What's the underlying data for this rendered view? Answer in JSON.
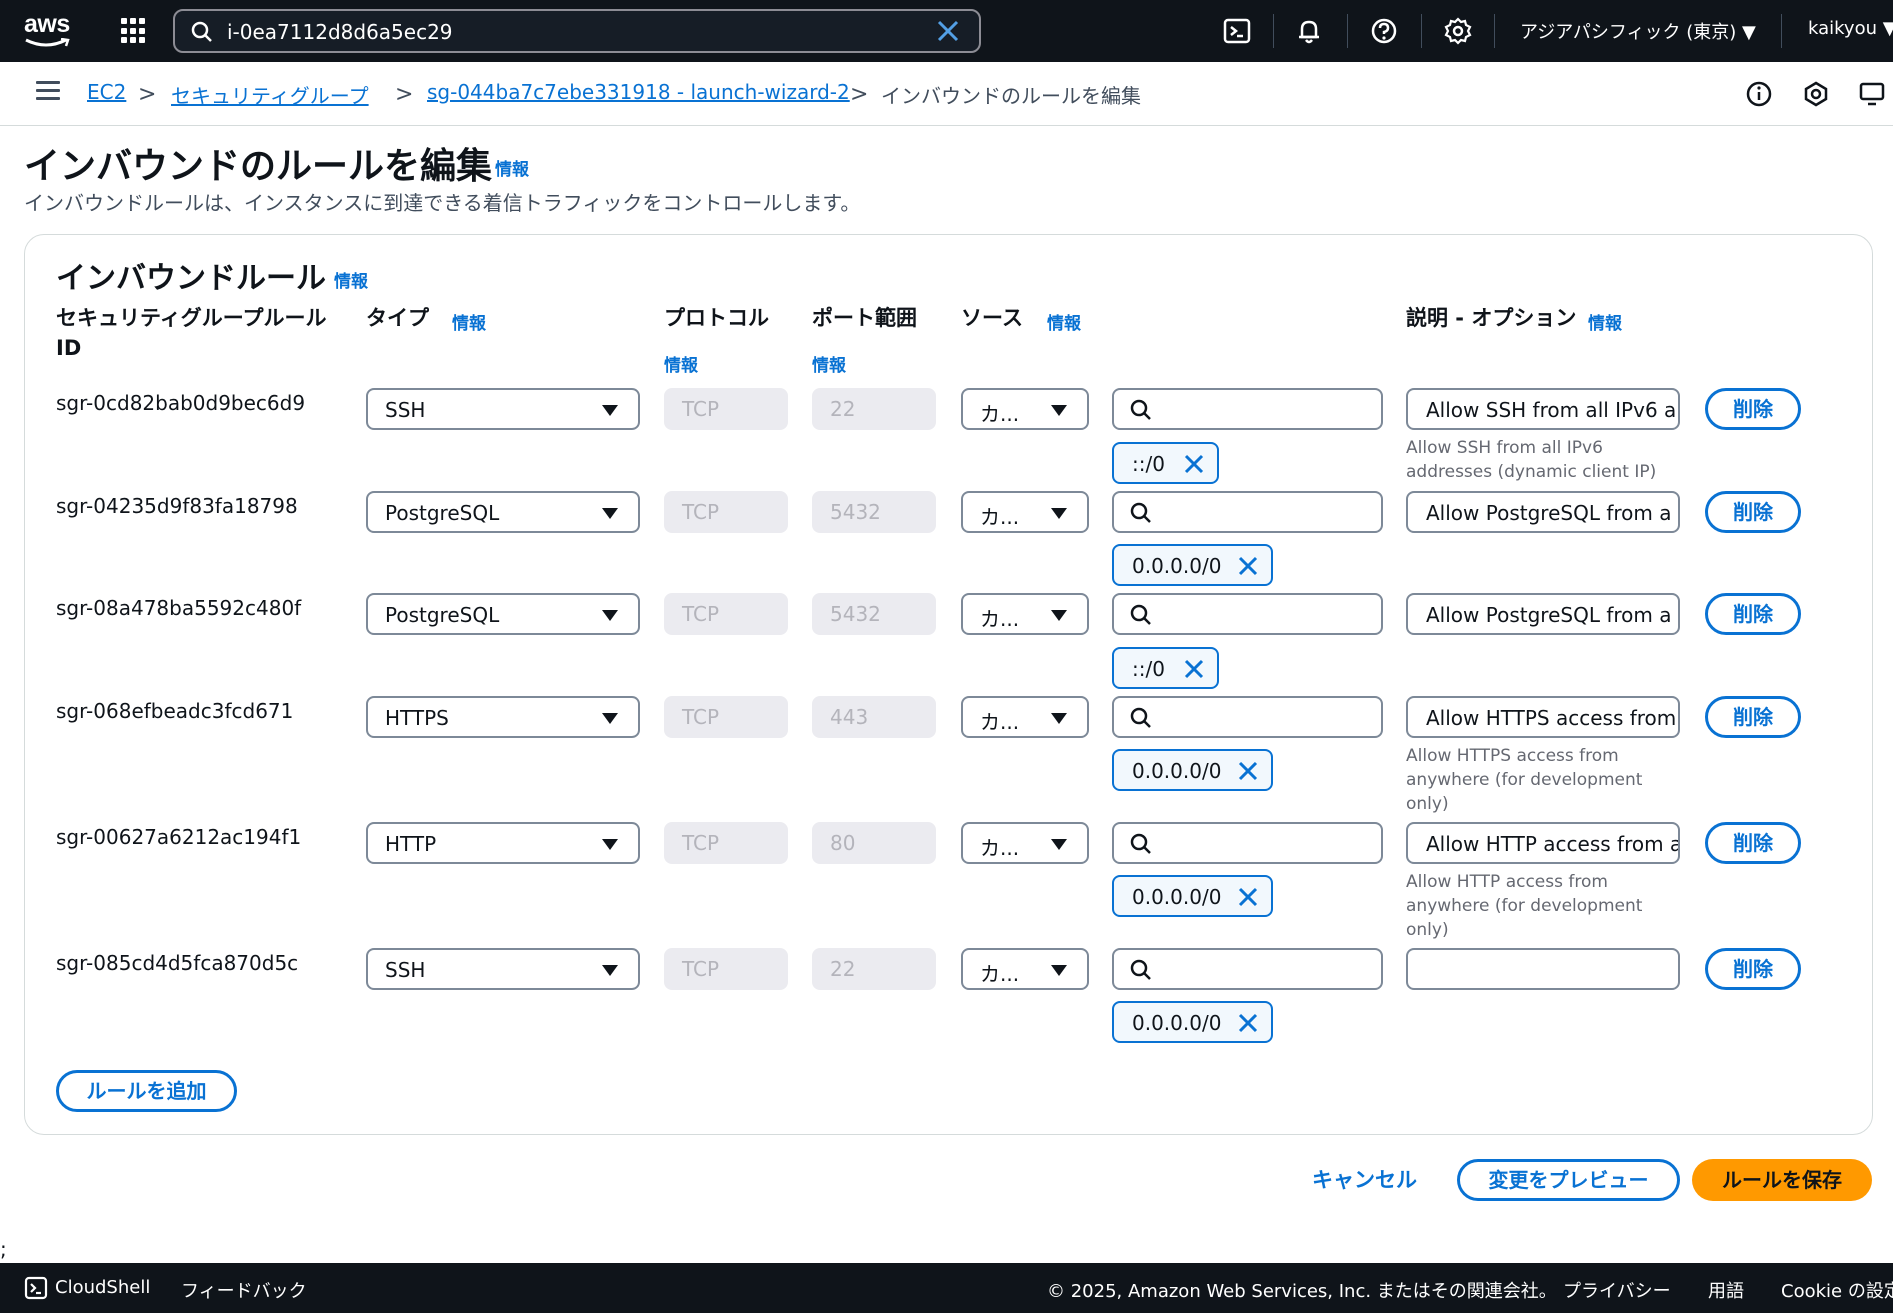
{
  "topnav": {
    "logo_text": "aws",
    "search_value": "i-0ea7112d8d6a5ec29",
    "region": "アジアパシフィック (東京) ▼",
    "user": "kaikyou ▼"
  },
  "breadcrumb": {
    "items": [
      "EC2",
      "セキュリティグループ",
      "sg-044ba7c7ebe331918 - launch-wizard-2",
      "インバウンドのルールを編集"
    ],
    "separator": ">"
  },
  "page": {
    "title": "インバウンドのルールを編集",
    "info": "情報",
    "description": "インバウンドルールは、インスタンスに到達できる着信トラフィックをコントロールします。"
  },
  "section": {
    "title": "インバウンドルール",
    "info": "情報",
    "columns": {
      "rule_id_line1": "セキュリティグループルール",
      "rule_id_line2": "ID",
      "type": "タイプ",
      "protocol": "プロトコル",
      "port_range": "ポート範囲",
      "source": "ソース",
      "description": "説明 - オプション"
    },
    "rules": [
      {
        "id": "sgr-0cd82bab0d9bec6d9",
        "type": "SSH",
        "protocol": "TCP",
        "port": "22",
        "source_type": "カ...",
        "cidr": "::/0",
        "description": "Allow SSH from all IPv6 a",
        "hint": "Allow SSH from all IPv6 addresses (dynamic client IP)"
      },
      {
        "id": "sgr-04235d9f83fa18798",
        "type": "PostgreSQL",
        "protocol": "TCP",
        "port": "5432",
        "source_type": "カ...",
        "cidr": "0.0.0.0/0",
        "description": "Allow PostgreSQL from a",
        "hint": ""
      },
      {
        "id": "sgr-08a478ba5592c480f",
        "type": "PostgreSQL",
        "protocol": "TCP",
        "port": "5432",
        "source_type": "カ...",
        "cidr": "::/0",
        "description": "Allow PostgreSQL from a",
        "hint": ""
      },
      {
        "id": "sgr-068efbeadc3fcd671",
        "type": "HTTPS",
        "protocol": "TCP",
        "port": "443",
        "source_type": "カ...",
        "cidr": "0.0.0.0/0",
        "description": "Allow HTTPS access from",
        "hint": "Allow HTTPS access from anywhere (for development only)"
      },
      {
        "id": "sgr-00627a6212ac194f1",
        "type": "HTTP",
        "protocol": "TCP",
        "port": "80",
        "source_type": "カ...",
        "cidr": "0.0.0.0/0",
        "description": "Allow HTTP access from a",
        "hint": "Allow HTTP access from anywhere (for development only)"
      },
      {
        "id": "sgr-085cd4d5fca870d5c",
        "type": "SSH",
        "protocol": "TCP",
        "port": "22",
        "source_type": "カ...",
        "cidr": "0.0.0.0/0",
        "description": "",
        "hint": ""
      }
    ],
    "delete_label": "削除",
    "add_rule_label": "ルールを追加"
  },
  "actions": {
    "cancel": "キャンセル",
    "preview": "変更をプレビュー",
    "save": "ルールを保存"
  },
  "stray_char": ";",
  "footer": {
    "cloudshell": "CloudShell",
    "feedback": "フィードバック",
    "copyright": "© 2025, Amazon Web Services, Inc. またはその関連会社。",
    "privacy": "プライバシー",
    "terms": "用語",
    "cookie": "Cookie の設定"
  },
  "colors": {
    "nav_bg": "#0f141a",
    "link": "#0972d3",
    "primary_button": "#ff9900",
    "readonly_bg": "#ebebf0"
  },
  "icons": [
    "aws-logo",
    "apps-grid-icon",
    "search-icon",
    "clear-icon",
    "cloudshell-icon",
    "bell-icon",
    "help-icon",
    "gear-icon",
    "menu-icon",
    "info-circle-icon",
    "hexagon-icon",
    "monitor-icon",
    "caret-down-icon",
    "remove-token-icon"
  ]
}
